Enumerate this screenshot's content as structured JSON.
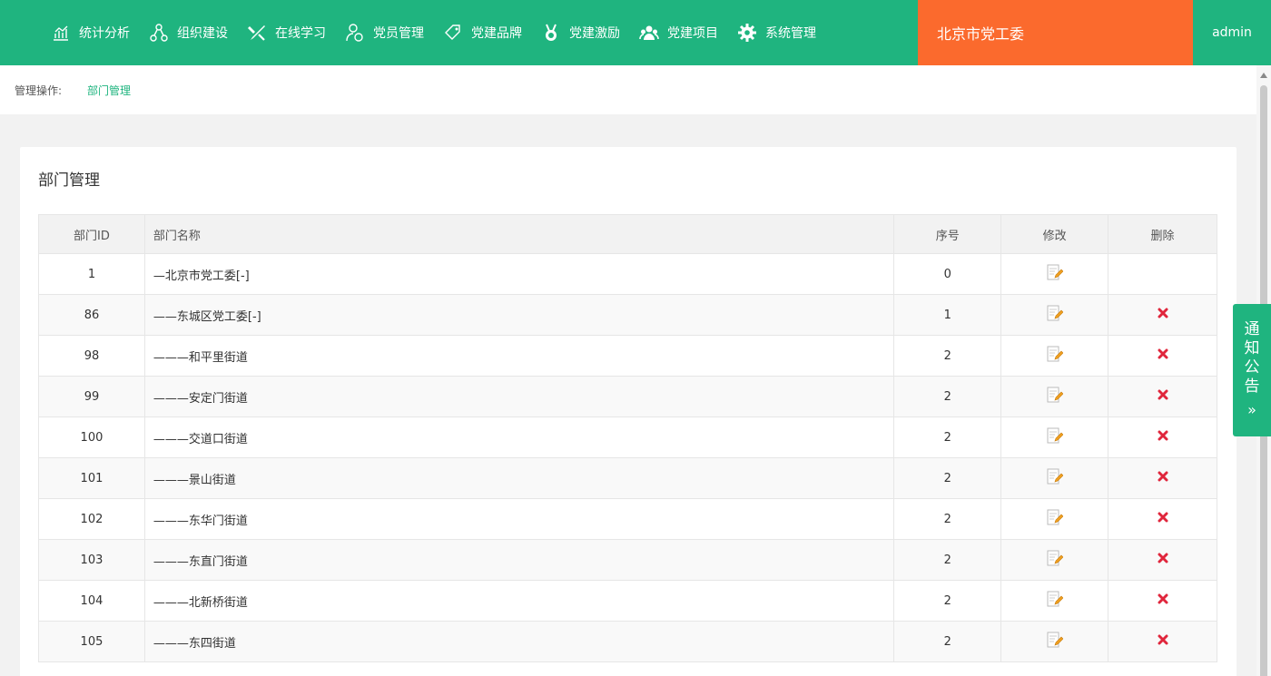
{
  "nav": {
    "items": [
      {
        "label": "统计分析",
        "icon": "chart-icon"
      },
      {
        "label": "组织建设",
        "icon": "org-tree-icon"
      },
      {
        "label": "在线学习",
        "icon": "tools-icon"
      },
      {
        "label": "党员管理",
        "icon": "member-icon"
      },
      {
        "label": "党建品牌",
        "icon": "tag-icon"
      },
      {
        "label": "党建激励",
        "icon": "medal-icon"
      },
      {
        "label": "党建项目",
        "icon": "group-icon"
      },
      {
        "label": "系统管理",
        "icon": "gear-icon"
      }
    ],
    "org_name": "北京市党工委",
    "user": "admin"
  },
  "breadcrumb": {
    "label": "管理操作:",
    "current": "部门管理"
  },
  "panel": {
    "title": "部门管理"
  },
  "table": {
    "headers": {
      "id": "部门ID",
      "name": "部门名称",
      "order": "序号",
      "edit": "修改",
      "delete": "删除"
    },
    "rows": [
      {
        "id": "1",
        "name": "—北京市党工委[-]",
        "order": "0",
        "deletable": false
      },
      {
        "id": "86",
        "name": "——东城区党工委[-]",
        "order": "1",
        "deletable": true
      },
      {
        "id": "98",
        "name": "———和平里街道",
        "order": "2",
        "deletable": true
      },
      {
        "id": "99",
        "name": "———安定门街道",
        "order": "2",
        "deletable": true
      },
      {
        "id": "100",
        "name": "———交道口街道",
        "order": "2",
        "deletable": true
      },
      {
        "id": "101",
        "name": "———景山街道",
        "order": "2",
        "deletable": true
      },
      {
        "id": "102",
        "name": "———东华门街道",
        "order": "2",
        "deletable": true
      },
      {
        "id": "103",
        "name": "———东直门街道",
        "order": "2",
        "deletable": true
      },
      {
        "id": "104",
        "name": "———北新桥街道",
        "order": "2",
        "deletable": true
      },
      {
        "id": "105",
        "name": "———东四街道",
        "order": "2",
        "deletable": true
      }
    ]
  },
  "notice": {
    "chars": [
      "通",
      "知",
      "公",
      "告"
    ],
    "arrow": "»"
  },
  "colors": {
    "primary": "#1fb47f",
    "accent": "#fb6a2d",
    "delete": "#e0263c"
  }
}
